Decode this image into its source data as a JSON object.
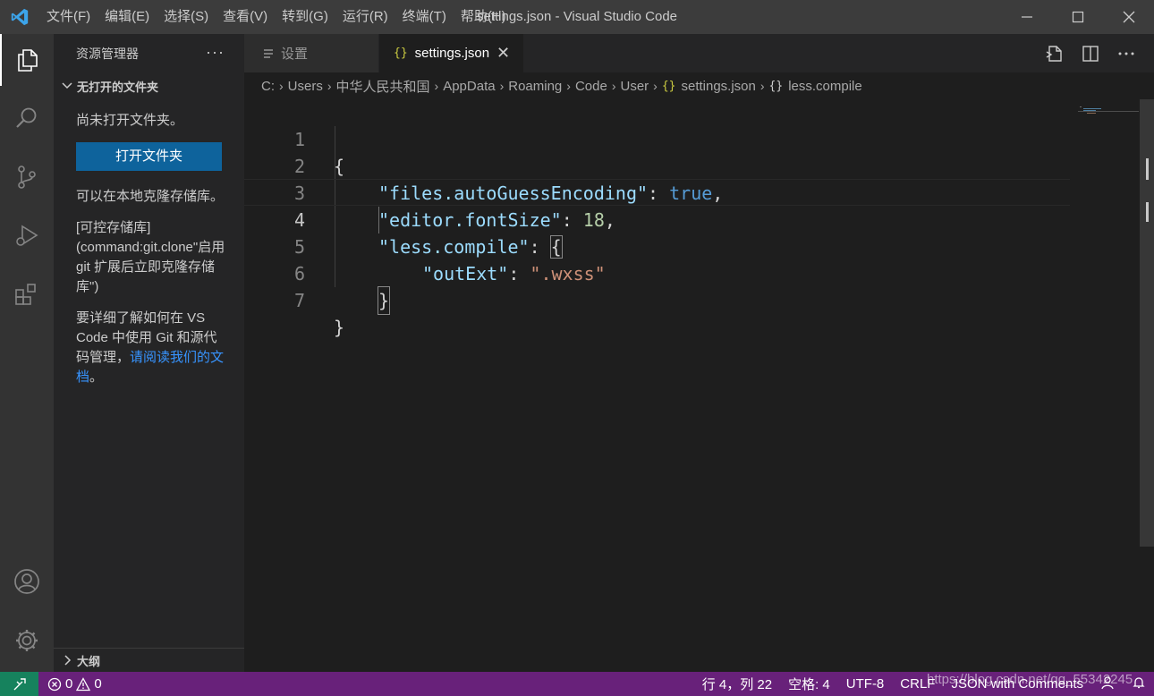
{
  "titlebar": {
    "title": "settings.json - Visual Studio Code",
    "menu": [
      "文件(F)",
      "编辑(E)",
      "选择(S)",
      "查看(V)",
      "转到(G)",
      "运行(R)",
      "终端(T)",
      "帮助(H)"
    ]
  },
  "activitybar": {
    "items": [
      "explorer-icon",
      "search-icon",
      "source-control-icon",
      "run-debug-icon",
      "extensions-icon",
      "accounts-icon",
      "manage-icon"
    ]
  },
  "sidebar": {
    "title": "资源管理器",
    "more": "···",
    "section_title": "无打开的文件夹",
    "no_folder_text": "尚未打开文件夹。",
    "open_folder_button": "打开文件夹",
    "clone_text": "可以在本地克隆存储库。",
    "clone_link_text": "[可控存储库](command:git.clone\"启用 git 扩展后立即克隆存储库\")",
    "learn_text": "要详细了解如何在 VS Code 中使用 Git 和源代码管理，",
    "learn_link": "请阅读我们的文档",
    "learn_end": "。",
    "outline_title": "大纲"
  },
  "tabs": [
    {
      "label": "设置",
      "active": false
    },
    {
      "label": "settings.json",
      "active": true,
      "icon": "{}"
    }
  ],
  "breadcrumb": {
    "parts": [
      "C:",
      "Users",
      "中华人民共和国",
      "AppData",
      "Roaming",
      "Code",
      "User"
    ],
    "file": "settings.json",
    "symbol": "less.compile"
  },
  "editor": {
    "lines": [
      {
        "num": "1",
        "text": "{"
      },
      {
        "num": "2",
        "key": "\"files.autoGuessEncoding\"",
        "colon": ": ",
        "value": "true",
        "trail": ","
      },
      {
        "num": "3",
        "key": "\"editor.fontSize\"",
        "colon": ": ",
        "value": "18",
        "trail": ","
      },
      {
        "num": "4",
        "key": "\"less.compile\"",
        "colon": ": ",
        "value": "{"
      },
      {
        "num": "5",
        "key": "\"outExt\"",
        "colon": ": ",
        "value": "\".wxss\""
      },
      {
        "num": "6",
        "text": "}"
      },
      {
        "num": "7",
        "text": "}"
      }
    ],
    "current_line": 4
  },
  "statusbar": {
    "errors": "0",
    "warnings": "0",
    "position": "行 4，列 22",
    "indent": "空格: 4",
    "encoding": "UTF-8",
    "eol": "CRLF",
    "language": "JSON with Comments",
    "watermark": "https://blog.csdn.net/qq_55342245"
  },
  "colors": {
    "statusbar": "#68217a",
    "remote": "#16825d",
    "button": "#0e639c",
    "link": "#3794ff"
  }
}
